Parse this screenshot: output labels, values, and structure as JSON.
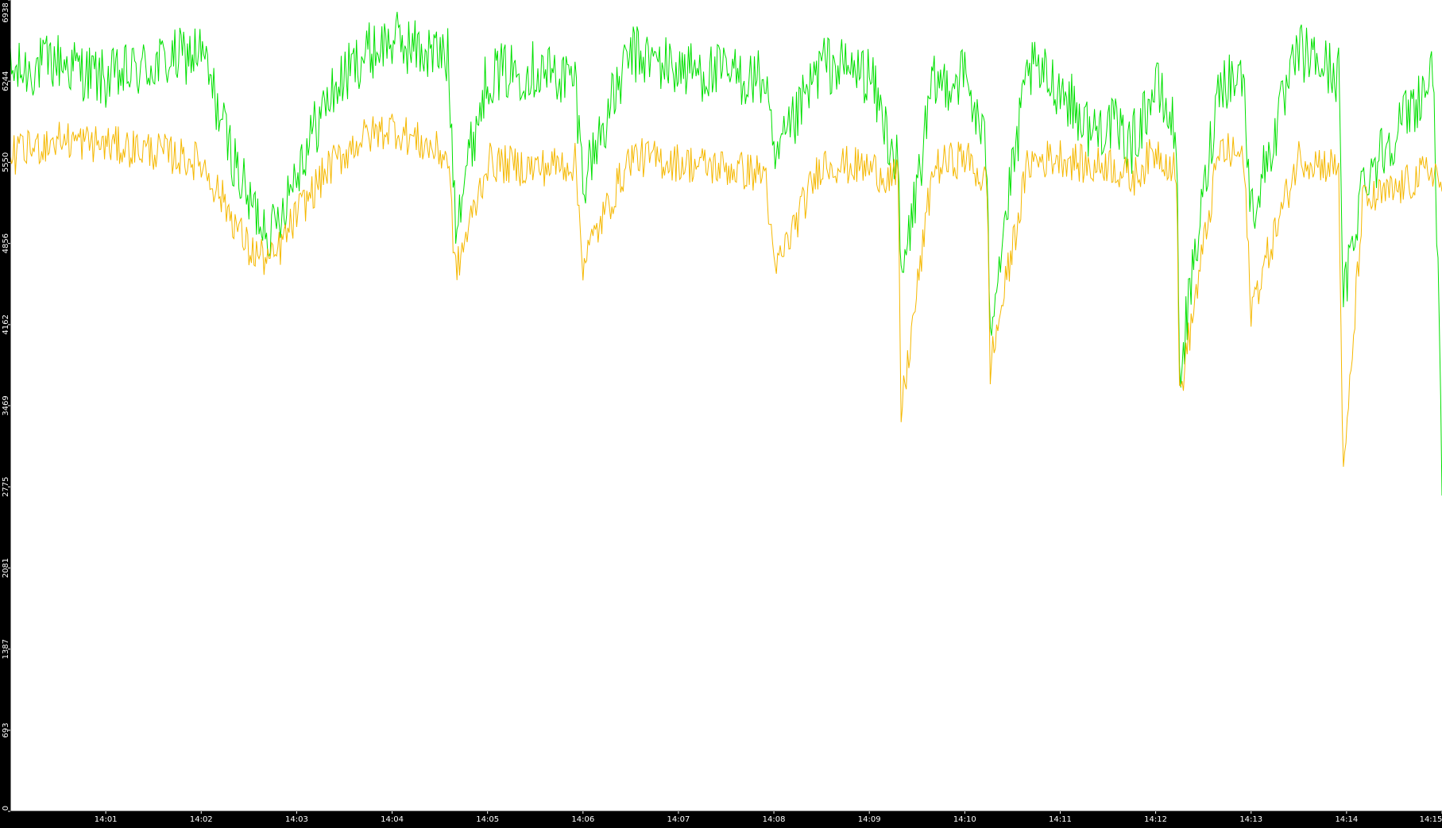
{
  "chart_data": {
    "type": "line",
    "title": "",
    "xlabel": "",
    "ylabel": "",
    "ylim": [
      0,
      6938
    ],
    "y_ticks": [
      0,
      693,
      1387,
      2081,
      2775,
      3469,
      4162,
      4856,
      5550,
      6244,
      6938
    ],
    "x_range_minutes": [
      "14:00",
      "14:15"
    ],
    "x_ticks": [
      "14:01",
      "14:02",
      "14:03",
      "14:04",
      "14:05",
      "14:06",
      "14:07",
      "14:08",
      "14:09",
      "14:10",
      "14:11",
      "14:12",
      "14:13",
      "14:14",
      "14:15"
    ],
    "grid": false,
    "legend": "none",
    "colors": {
      "background": "#000000",
      "plot_area": "#ffffff",
      "axis": "#000000",
      "tick_text": "#ffffff"
    },
    "series": [
      {
        "color": "#00e000",
        "x": [
          "14:00:00",
          "14:00:30",
          "14:01:00",
          "14:01:30",
          "14:02:00",
          "14:02:15",
          "14:02:30",
          "14:02:45",
          "14:03:00",
          "14:03:20",
          "14:03:40",
          "14:04:00",
          "14:04:20",
          "14:04:35",
          "14:04:40",
          "14:05:00",
          "14:05:30",
          "14:05:55",
          "14:06:00",
          "14:06:30",
          "14:07:00",
          "14:07:30",
          "14:07:55",
          "14:08:00",
          "14:08:30",
          "14:09:00",
          "14:09:18",
          "14:09:20",
          "14:09:40",
          "14:10:00",
          "14:10:14",
          "14:10:16",
          "14:10:40",
          "14:11:00",
          "14:11:20",
          "14:11:30",
          "14:11:45",
          "14:12:00",
          "14:12:13",
          "14:12:15",
          "14:12:40",
          "14:12:55",
          "14:13:00",
          "14:13:30",
          "14:13:55",
          "14:13:58",
          "14:14:10",
          "14:14:30",
          "14:14:55",
          "14:15:00"
        ],
        "values": [
          6300,
          6420,
          6250,
          6380,
          6500,
          5800,
          5200,
          4950,
          5500,
          6100,
          6450,
          6600,
          6500,
          6450,
          5100,
          6300,
          6350,
          6250,
          5400,
          6480,
          6350,
          6300,
          6250,
          5500,
          6400,
          6300,
          5500,
          4500,
          6200,
          6300,
          5600,
          4200,
          6350,
          6200,
          5800,
          5900,
          5700,
          6200,
          5800,
          3750,
          6250,
          6300,
          5100,
          6500,
          6300,
          4350,
          5400,
          5800,
          6300,
          2700
        ]
      },
      {
        "color": "#f5b800",
        "x": [
          "14:00:00",
          "14:00:30",
          "14:01:00",
          "14:01:30",
          "14:02:00",
          "14:02:15",
          "14:02:30",
          "14:02:45",
          "14:03:00",
          "14:03:20",
          "14:03:40",
          "14:04:00",
          "14:04:20",
          "14:04:35",
          "14:04:40",
          "14:05:00",
          "14:05:30",
          "14:05:55",
          "14:06:00",
          "14:06:30",
          "14:07:00",
          "14:07:30",
          "14:07:55",
          "14:08:00",
          "14:08:30",
          "14:09:00",
          "14:09:18",
          "14:09:20",
          "14:09:40",
          "14:10:00",
          "14:10:14",
          "14:10:16",
          "14:10:40",
          "14:11:00",
          "14:11:20",
          "14:11:30",
          "14:11:45",
          "14:12:00",
          "14:12:13",
          "14:12:15",
          "14:12:40",
          "14:12:55",
          "14:13:00",
          "14:13:30",
          "14:13:55",
          "14:13:58",
          "14:14:10",
          "14:14:30",
          "14:14:55",
          "14:15:00"
        ],
        "values": [
          5600,
          5750,
          5700,
          5650,
          5550,
          5200,
          4800,
          4700,
          5100,
          5500,
          5750,
          5850,
          5700,
          5600,
          4600,
          5550,
          5500,
          5550,
          4700,
          5600,
          5550,
          5500,
          5450,
          4600,
          5550,
          5500,
          5400,
          3400,
          5500,
          5600,
          5350,
          3800,
          5550,
          5600,
          5500,
          5550,
          5400,
          5650,
          5500,
          3550,
          5650,
          5600,
          4300,
          5600,
          5500,
          2800,
          5200,
          5300,
          5500,
          5300
        ]
      }
    ]
  }
}
